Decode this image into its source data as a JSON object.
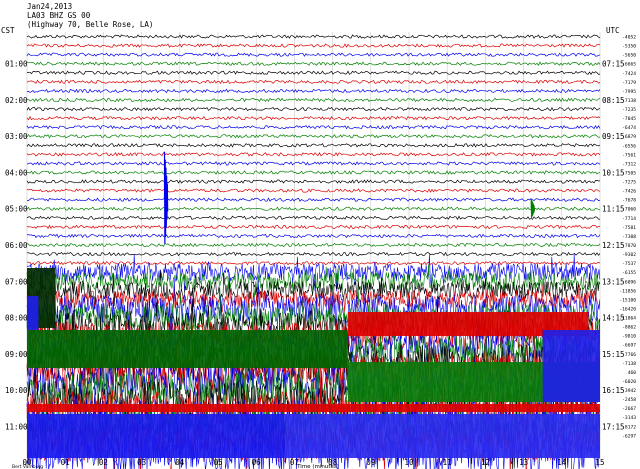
{
  "header": {
    "date": "Jan24,2013",
    "channel": "LA03 BHZ GS 00",
    "location": "(Highway 70, Belle Rose, LA)"
  },
  "left_tz": "CST",
  "right_tz": "UTC",
  "footer": {
    "left_note": "Bert Vamburg",
    "center_note": "Time (minutes)"
  },
  "chart_data": {
    "type": "seismogram-helicorder",
    "line_count": 47,
    "line_duration_minutes": 15,
    "trace_colors": [
      "#000000",
      "#dd0000",
      "#0000ee",
      "#008000"
    ],
    "left_hour_labels": [
      "01:00",
      "02:00",
      "03:00",
      "04:00",
      "05:00",
      "06:00",
      "07:00",
      "08:00",
      "09:00",
      "10:00",
      "11:00"
    ],
    "right_hour_labels": [
      "07:15",
      "08:15",
      "09:15",
      "10:15",
      "11:15",
      "12:15",
      "13:15",
      "14:15",
      "15:15",
      "16:15",
      "17:15"
    ],
    "first_right_label": "UTC",
    "x_ticks": [
      "00",
      "01",
      "02",
      "03",
      "04",
      "05",
      "06",
      "07",
      "08",
      "09",
      "10",
      "11",
      "12",
      "13",
      "14",
      "15"
    ],
    "line_offsets": [
      "-4052",
      "-5350",
      "-5650",
      "-6665",
      "-7424",
      "-7179",
      "-7995",
      "-7138",
      "-7235",
      "-7045",
      "-6474",
      "-6879",
      "-6556",
      "-7561",
      "-7312",
      "-7505",
      "-7275",
      "-7426",
      "-7678",
      "-7060",
      "-7714",
      "-7581",
      "-7308",
      "-7870",
      "-9302",
      "-7537",
      "-6155",
      "-6096",
      "-11856",
      "-15100",
      "-16420",
      "-11864",
      "-8862",
      "-9810",
      "-6697",
      "-7766",
      "-7138",
      "460",
      "-6020",
      "-3942",
      "-2458",
      "-2667",
      "-3143",
      "-8172",
      "-6297"
    ],
    "events": [
      {
        "label": "large spike",
        "line": 18,
        "minute": 3.6
      },
      {
        "label": "small spike",
        "line": 19,
        "minute": 13.2
      },
      {
        "label": "noise onset",
        "line": 26,
        "minute": 0
      }
    ]
  }
}
